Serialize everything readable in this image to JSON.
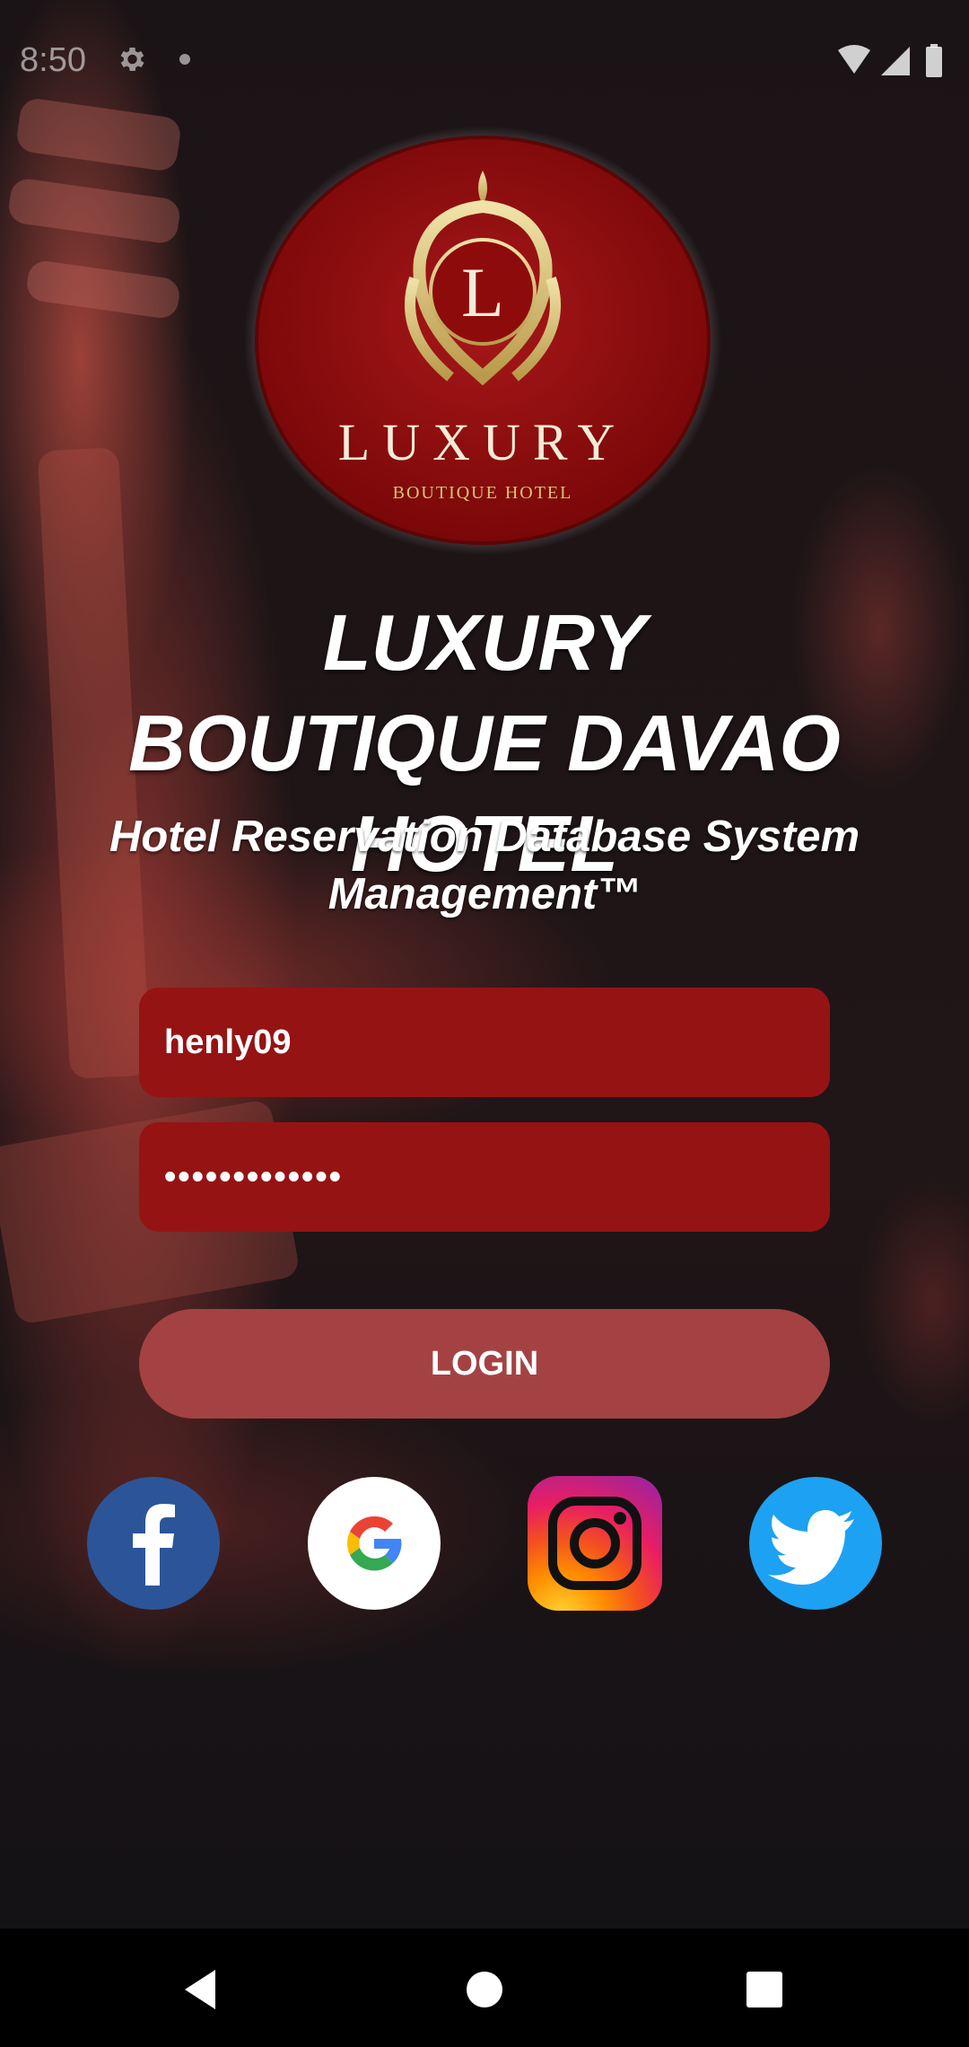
{
  "status_bar": {
    "time": "8:50",
    "icons": [
      "gear-icon",
      "notification-dot-icon",
      "wifi-icon",
      "signal-icon",
      "battery-icon"
    ]
  },
  "logo": {
    "initial": "L",
    "name": "LUXURY",
    "tagline": "BOUTIQUE HOTEL",
    "colors": {
      "badge": "#8e0b0c",
      "gold": "#d9c27a"
    }
  },
  "header": {
    "title": "LUXURY BOUTIQUE DAVAO HOTEL",
    "subtitle": "Hotel Reservation Database System Management™"
  },
  "form": {
    "username_value": "henly09",
    "password_value": "•••••••••••••",
    "login_label": "LOGIN"
  },
  "social": [
    {
      "name": "facebook",
      "icon": "facebook-icon",
      "color": "#3b5998"
    },
    {
      "name": "google",
      "icon": "google-icon",
      "color": "#ffffff"
    },
    {
      "name": "instagram",
      "icon": "instagram-icon",
      "color": "#c13584"
    },
    {
      "name": "twitter",
      "icon": "twitter-icon",
      "color": "#1da1f2"
    }
  ],
  "nav_bar": {
    "buttons": [
      "back-icon",
      "home-icon",
      "recents-icon"
    ]
  },
  "colors": {
    "field_bg": "#961314",
    "login_bg": "#a44243",
    "background": "#141215"
  }
}
